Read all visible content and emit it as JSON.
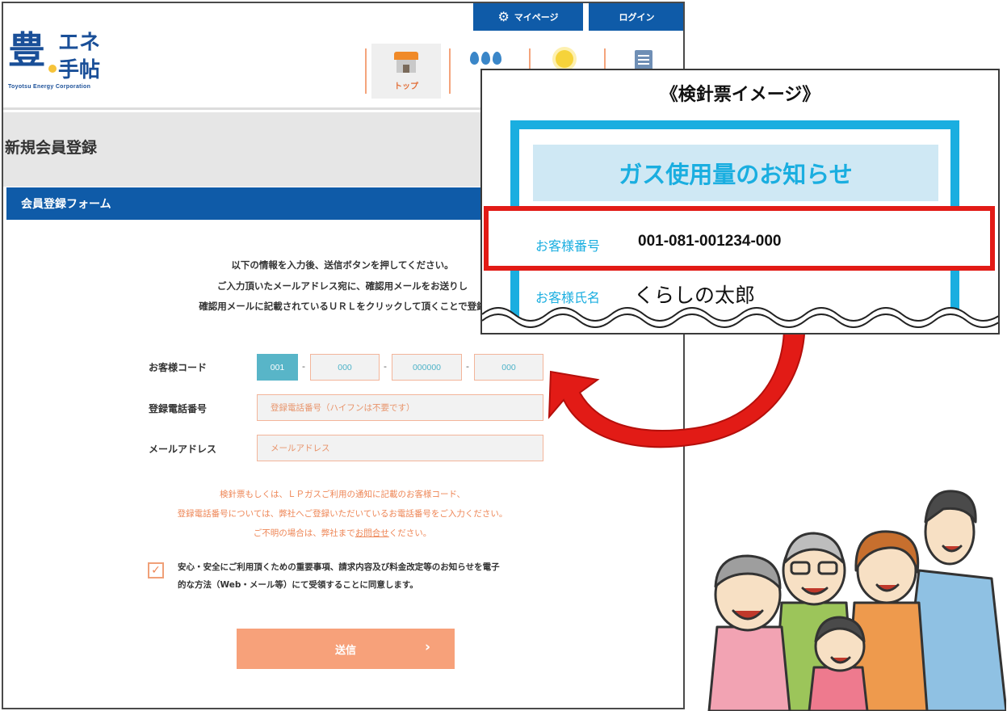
{
  "header": {
    "logo_kanji": "豊",
    "logo_line1": "エネ",
    "logo_line2": "手帖",
    "logo_sub": "Toyotsu Energy Corporation",
    "mypage_label": "マイページ",
    "login_label": "ログイン",
    "nav_top_label": "トップ"
  },
  "page": {
    "title": "新規会員登録",
    "form_title": "会員登録フォーム",
    "intro": [
      "以下の情報を入力後、送信ボタンを押してください。",
      "ご入力頂いたメールアドレス宛に、確認用メールをお送りし",
      "確認用メールに記載されているＵＲＬをクリックして頂くことで登録"
    ]
  },
  "form": {
    "customer_code_label": "お客様コード",
    "code_values": [
      "001",
      "000",
      "000000",
      "000"
    ],
    "code_separator": "-",
    "phone_label": "登録電話番号",
    "phone_placeholder": "登録電話番号（ハイフンは不要です）",
    "email_label": "メールアドレス",
    "email_placeholder": "メールアドレス",
    "notes": [
      "検針票もしくは、ＬＰガスご利用の通知に記載のお客様コード、",
      "登録電話番号については、弊社へご登録いただいているお電話番号をご入力ください。"
    ],
    "note_last_prefix": "ご不明の場合は、弊社まで",
    "note_last_link": "お問合せ",
    "note_last_suffix": "ください。",
    "agree_checked": true,
    "agree_line1": "安心・安全にご利用頂くための重要事項、請求内容及び料金改定等のお知らせを電子",
    "agree_line2": "的な方法（Web・メール等）にて受領することに同意します。",
    "submit_label": "送信"
  },
  "ticket": {
    "title": "《検針票イメージ》",
    "heading": "ガス使用量のお知らせ",
    "customer_number_label": "お客様番号",
    "customer_number_value": "001-081-001234-000",
    "customer_name_label": "お客様氏名",
    "customer_name_value": "くらしの太郎"
  },
  "colors": {
    "brand_blue": "#0f5ba8",
    "accent_orange": "#f7a17a",
    "ticket_cyan": "#1aaee0",
    "highlight_red": "#e21b16"
  }
}
